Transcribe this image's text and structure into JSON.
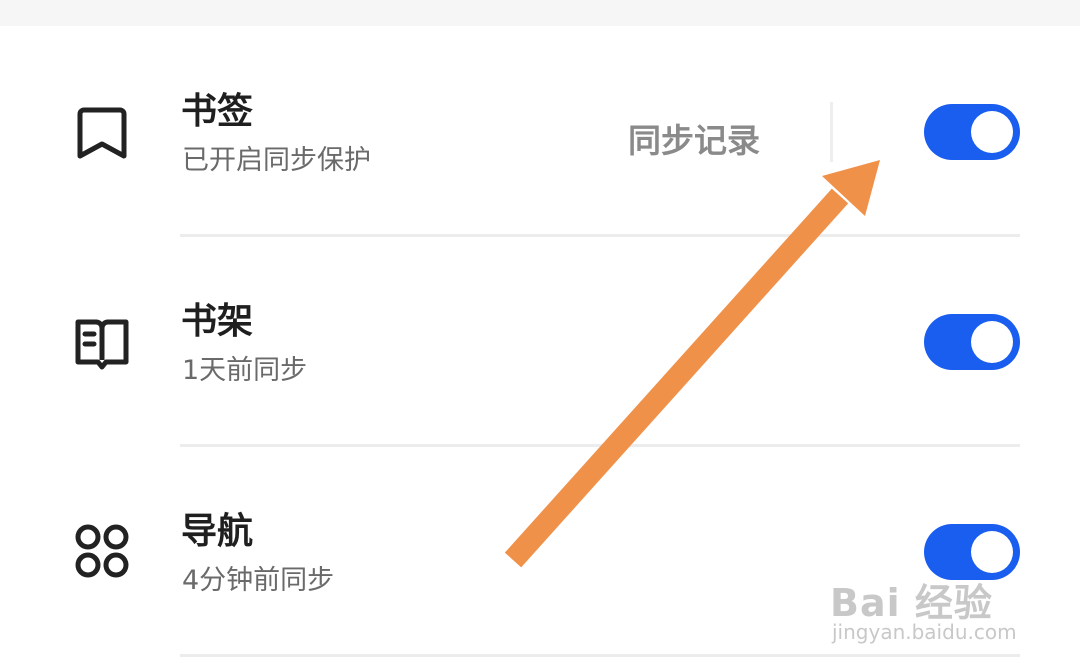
{
  "settings": {
    "items": [
      {
        "title": "书签",
        "subtitle": "已开启同步保护",
        "icon": "bookmark-icon",
        "enabled": true
      },
      {
        "title": "书架",
        "subtitle": "1天前同步",
        "icon": "bookshelf-icon",
        "enabled": true
      },
      {
        "title": "导航",
        "subtitle": "4分钟前同步",
        "icon": "navigation-grid-icon",
        "enabled": true
      }
    ],
    "sync_record_label": "同步记录"
  },
  "annotation": {
    "arrow_color": "#f0914a"
  },
  "watermark": {
    "main": "Bai 经验",
    "sub": "jingyan.baidu.com"
  },
  "colors": {
    "toggle_on": "#1a5ef0",
    "title": "#1f1f1f",
    "subtitle": "#6a6a6a"
  }
}
